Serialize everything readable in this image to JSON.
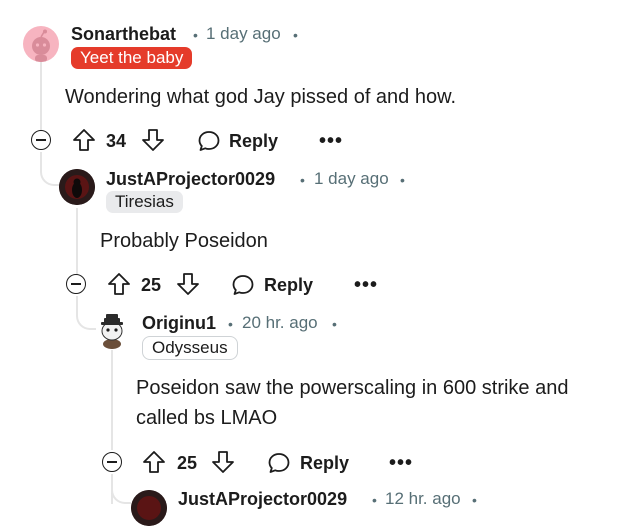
{
  "comments": [
    {
      "username": "Sonarthebat",
      "time": "1 day ago",
      "flair": "Yeet the baby",
      "text": "Wondering what god Jay pissed of and how.",
      "votes": "34",
      "reply_label": "Reply"
    },
    {
      "username": "JustAProjector0029",
      "time": "1 day ago",
      "flair": "Tiresias",
      "text": "Probably Poseidon",
      "votes": "25",
      "reply_label": "Reply"
    },
    {
      "username": "Originu1",
      "time": "20 hr. ago",
      "flair": "Odysseus",
      "text_line1": "Poseidon saw the powerscaling in 600 strike and",
      "text_line2": "called bs LMAO",
      "votes": "25",
      "reply_label": "Reply"
    },
    {
      "username": "JustAProjector0029",
      "time": "12 hr. ago"
    }
  ],
  "separator": "•",
  "more_glyph": "•••",
  "icons": {
    "collapse": "minus-circle-icon",
    "upvote": "arrow-up-icon",
    "downvote": "arrow-down-icon",
    "reply": "speech-bubble-icon",
    "more": "ellipsis-icon"
  },
  "colors": {
    "flair_red": "#e53b2a",
    "meta": "#576f76",
    "thread_line": "#e5e5e5"
  }
}
